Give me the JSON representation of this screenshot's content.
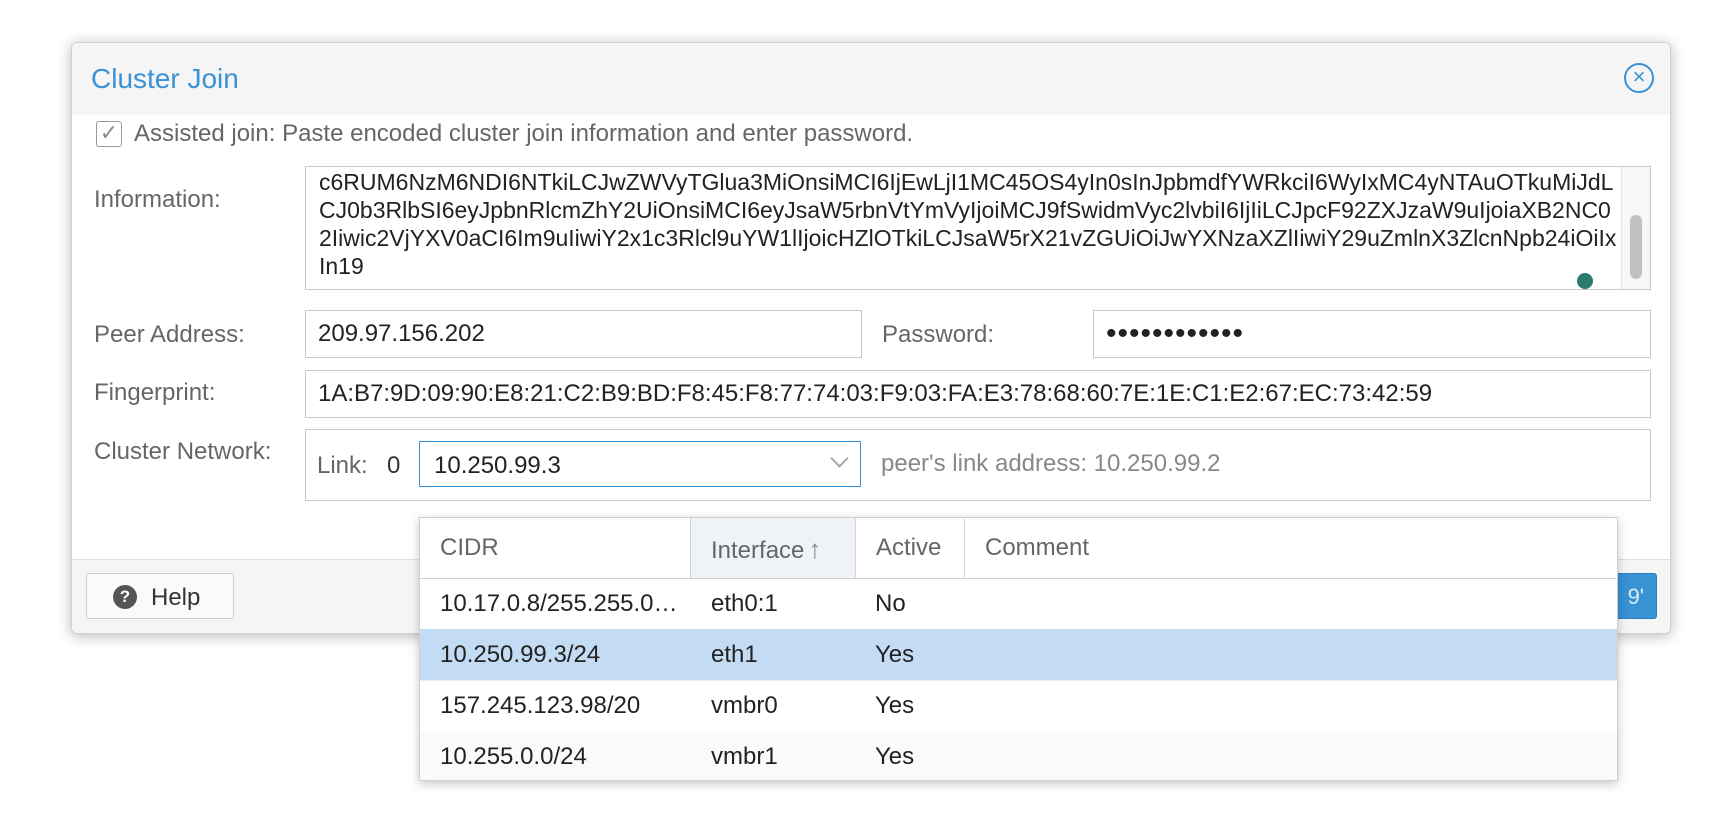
{
  "dialog": {
    "title": "Cluster Join",
    "assisted_join_label": "Assisted join: Paste encoded cluster join information and enter password.",
    "assisted_join_checked": true,
    "information_label": "Information:",
    "information_value": "c6RUM6NzM6NDI6NTkiLCJwZWVyTGlua3MiOnsiMCI6IjEwLjI1MC45OS4yIn0sInJpbmdfYWRkciI6WyIxMC4yNTAuOTkuMiJdLCJ0b3RlbSI6eyJpbnRlcmZhY2UiOnsiMCI6eyJsaW5rbnVtYmVyIjoiMCJ9fSwidmVyc2lvbiI6IjIiLCJpcF92ZXJzaW9uIjoiaXB2NC02Iiwic2VjYXV0aCI6Im9uIiwiY2x1c3Rlcl9uYW1lIjoicHZlOTkiLCJsaW5rX21vZGUiOiJwYXNzaXZlIiwiY29uZmlnX3ZlcnNpb24iOiIxIn19",
    "peer_address_label": "Peer Address:",
    "peer_address_value": "209.97.156.202",
    "password_label": "Password:",
    "password_value": "••••••••••••",
    "fingerprint_label": "Fingerprint:",
    "fingerprint_value": "1A:B7:9D:09:90:E8:21:C2:B9:BD:F8:45:F8:77:74:03:F9:03:FA:E3:78:68:60:7E:1E:C1:E2:67:EC:73:42:59",
    "cluster_network_label": "Cluster Network:",
    "link_label": "Link:",
    "link_number": "0",
    "link_select_value": "10.250.99.3",
    "peer_link_address": "peer's link address: 10.250.99.2",
    "help_label": "Help",
    "join_button_label": "9'"
  },
  "network_grid": {
    "columns": [
      "CIDR",
      "Interface",
      "Active",
      "Comment"
    ],
    "sorted_column": "Interface",
    "sort_direction": "ascending",
    "rows": [
      {
        "cidr": "10.17.0.8/255.255.0…",
        "interface": "eth0:1",
        "active": "No",
        "comment": ""
      },
      {
        "cidr": "10.250.99.3/24",
        "interface": "eth1",
        "active": "Yes",
        "comment": "",
        "selected": true
      },
      {
        "cidr": "157.245.123.98/20",
        "interface": "vmbr0",
        "active": "Yes",
        "comment": ""
      },
      {
        "cidr": "10.255.0.0/24",
        "interface": "vmbr1",
        "active": "Yes",
        "comment": ""
      }
    ]
  },
  "icons": {
    "close": "close-icon",
    "help": "help-icon",
    "dropdown": "chevron-down-icon",
    "sort": "sort-ascending-icon",
    "checkbox": "checkbox-checked-icon"
  },
  "colors": {
    "accent": "#3892d4",
    "selected_row": "#c4dcf3",
    "header_bg": "#f5f5f5",
    "label_text": "#666666"
  }
}
